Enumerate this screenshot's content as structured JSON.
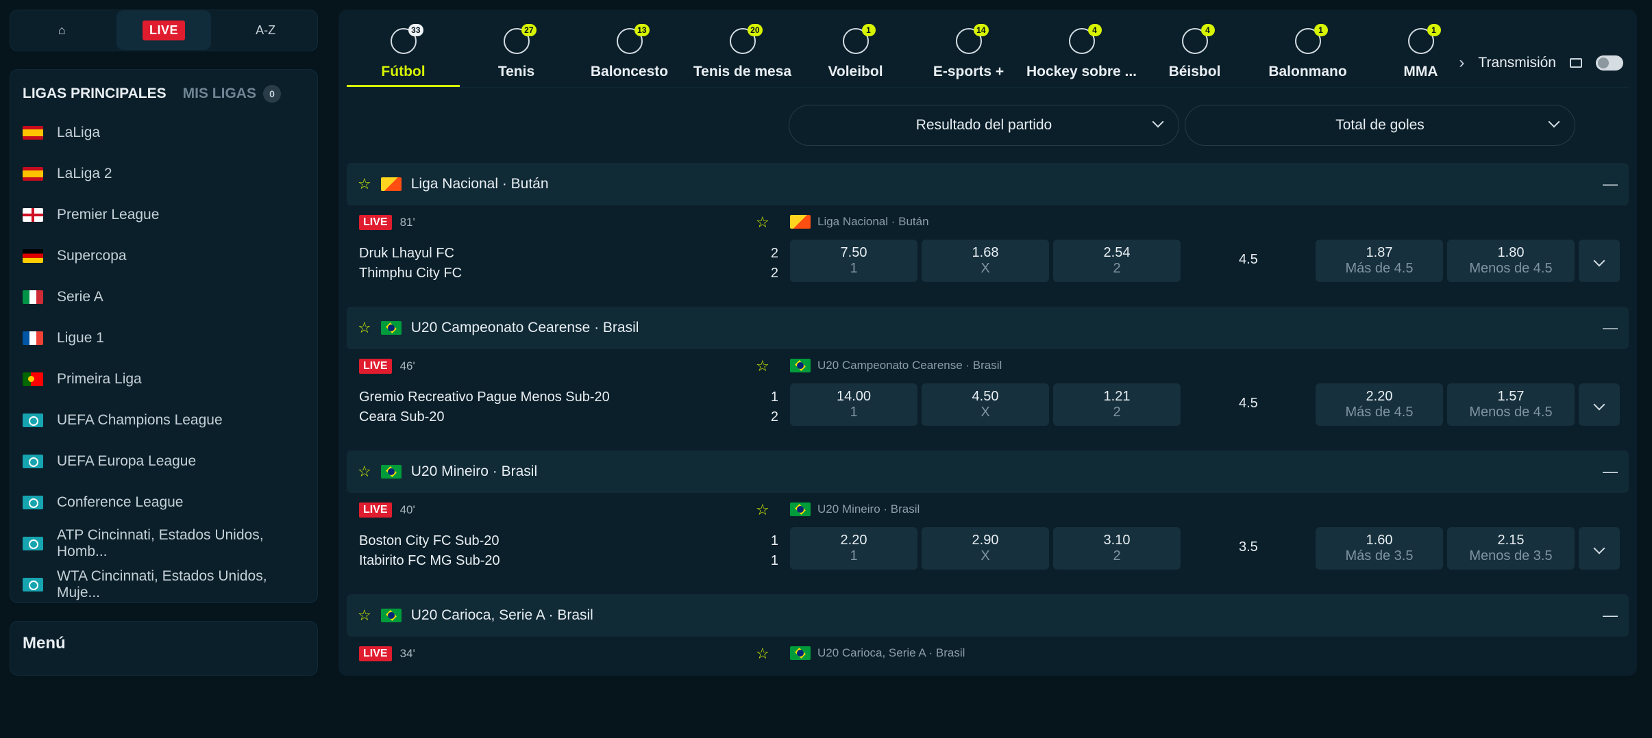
{
  "sidebar": {
    "nav": {
      "home_icon": "home-icon",
      "live": "LIVE",
      "az": "A-Z"
    },
    "leagues_title": "LIGAS PRINCIPALES",
    "my_leagues": {
      "label": "MIS LIGAS",
      "count": "0"
    },
    "items": [
      {
        "label": "LaLiga",
        "flag": "es"
      },
      {
        "label": "LaLiga 2",
        "flag": "es"
      },
      {
        "label": "Premier League",
        "flag": "en"
      },
      {
        "label": "Supercopa",
        "flag": "de"
      },
      {
        "label": "Serie A",
        "flag": "it"
      },
      {
        "label": "Ligue 1",
        "flag": "fr"
      },
      {
        "label": "Primeira Liga",
        "flag": "pt"
      },
      {
        "label": "UEFA Champions League",
        "flag": "globe"
      },
      {
        "label": "UEFA Europa League",
        "flag": "globe"
      },
      {
        "label": "Conference League",
        "flag": "globe"
      },
      {
        "label": "ATP Cincinnati, Estados Unidos, Homb...",
        "flag": "globe"
      },
      {
        "label": "WTA Cincinnati, Estados Unidos, Muje...",
        "flag": "globe"
      }
    ],
    "menu": "Menú"
  },
  "sports": [
    {
      "label": "Fútbol",
      "count": "33"
    },
    {
      "label": "Tenis",
      "count": "27"
    },
    {
      "label": "Baloncesto",
      "count": "13"
    },
    {
      "label": "Tenis de mesa",
      "count": "20"
    },
    {
      "label": "Voleibol",
      "count": "1"
    },
    {
      "label": "E-sports +",
      "count": "14"
    },
    {
      "label": "Hockey sobre ...",
      "count": "4"
    },
    {
      "label": "Béisbol",
      "count": "4"
    },
    {
      "label": "Balonmano",
      "count": "1"
    },
    {
      "label": "MMA",
      "count": "1"
    }
  ],
  "stream": {
    "label": "Transmisión"
  },
  "markets": {
    "first": "Resultado del partido",
    "second": "Total de goles"
  },
  "groups": [
    {
      "league": "Liga Nacional · Bután",
      "flag": "bt",
      "match": {
        "minute": "81'",
        "team1": "Druk Lhayul FC",
        "team2": "Thimphu City FC",
        "score1": "2",
        "score2": "2",
        "odds": [
          {
            "v": "7.50",
            "k": "1"
          },
          {
            "v": "1.68",
            "k": "X"
          },
          {
            "v": "2.54",
            "k": "2"
          }
        ],
        "line": "4.5",
        "ou": [
          {
            "v": "1.87",
            "k": "Más de 4.5"
          },
          {
            "v": "1.80",
            "k": "Menos de 4.5"
          }
        ]
      }
    },
    {
      "league": "U20 Campeonato Cearense · Brasil",
      "flag": "br",
      "match": {
        "minute": "46'",
        "team1": "Gremio Recreativo Pague Menos Sub-20",
        "team2": "Ceara Sub-20",
        "score1": "1",
        "score2": "2",
        "odds": [
          {
            "v": "14.00",
            "k": "1"
          },
          {
            "v": "4.50",
            "k": "X"
          },
          {
            "v": "1.21",
            "k": "2"
          }
        ],
        "line": "4.5",
        "ou": [
          {
            "v": "2.20",
            "k": "Más de 4.5"
          },
          {
            "v": "1.57",
            "k": "Menos de 4.5"
          }
        ]
      }
    },
    {
      "league": "U20 Mineiro · Brasil",
      "flag": "br",
      "match": {
        "minute": "40'",
        "team1": "Boston City FC Sub-20",
        "team2": "Itabirito FC MG Sub-20",
        "score1": "1",
        "score2": "1",
        "odds": [
          {
            "v": "2.20",
            "k": "1"
          },
          {
            "v": "2.90",
            "k": "X"
          },
          {
            "v": "3.10",
            "k": "2"
          }
        ],
        "line": "3.5",
        "ou": [
          {
            "v": "1.60",
            "k": "Más de 3.5"
          },
          {
            "v": "2.15",
            "k": "Menos de 3.5"
          }
        ]
      }
    },
    {
      "league": "U20 Carioca, Serie A · Brasil",
      "flag": "br",
      "match": {
        "minute": "34'"
      }
    }
  ]
}
